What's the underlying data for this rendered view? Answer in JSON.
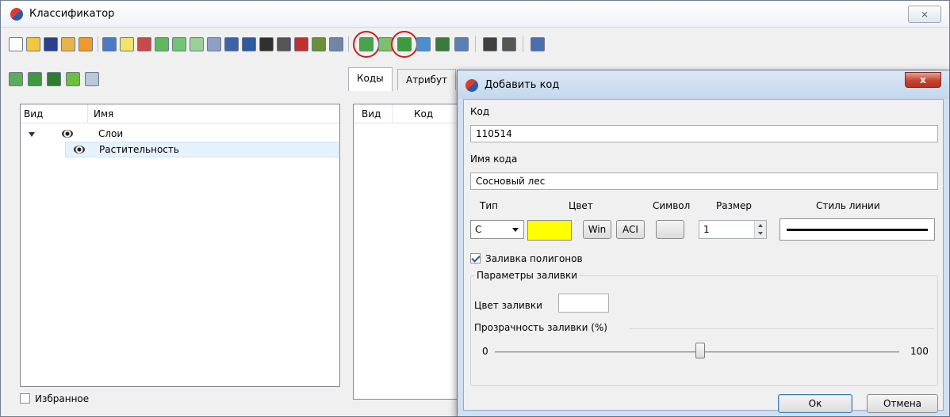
{
  "main_window": {
    "title": "Классификатор",
    "close_symbol": "⨯"
  },
  "tree": {
    "col_view": "Вид",
    "col_name": "Имя",
    "rows": [
      {
        "label": "Слои"
      },
      {
        "label": "Растительность"
      }
    ],
    "favorites_label": "Избранное"
  },
  "tabs": {
    "codes": "Коды",
    "attributes": "Атрибут"
  },
  "codes_table": {
    "col_view": "Вид",
    "col_code": "Код"
  },
  "dialog": {
    "title": "Добавить код",
    "close_symbol": "x",
    "code_label": "Код",
    "code_value": "110514",
    "name_label": "Имя кода",
    "name_value": "Сосновый лес",
    "type_label": "Тип",
    "type_value": "C",
    "color_label": "Цвет",
    "color_value": "#ffff00",
    "win_button": "Win",
    "aci_button": "ACI",
    "symbol_label": "Символ",
    "size_label": "Размер",
    "size_value": "1",
    "line_style_label": "Стиль линии",
    "fill_polygons_label": "Заливка полигонов",
    "fill_polygons_checked": true,
    "fill_params_title": "Параметры заливки",
    "fill_color_label": "Цвет заливки",
    "transparency_label": "Прозрачность заливки (%)",
    "slider_min": "0",
    "slider_max": "100",
    "slider_value": 48,
    "ok_button": "Ок",
    "cancel_button": "Отмена"
  },
  "icons": {
    "highlighted_toolbar_buttons": [
      "add-code-icon",
      "add-layer-code-icon"
    ],
    "highlight_color": "#d31b1b"
  }
}
